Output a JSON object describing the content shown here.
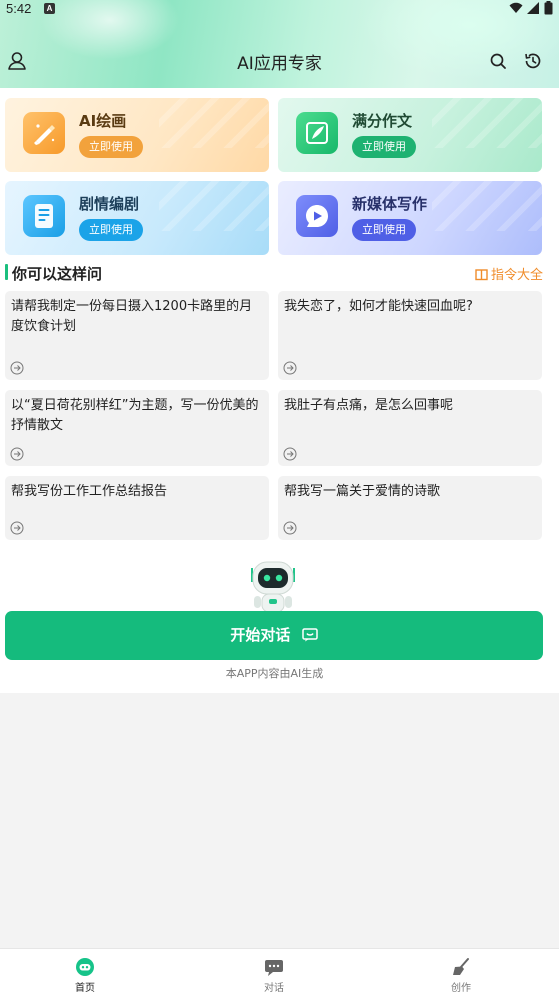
{
  "status_bar": {
    "time": "5:42",
    "notif": "A"
  },
  "header": {
    "title": "AI应用专家"
  },
  "cards": [
    {
      "title": "AI绘画",
      "button": "立即使用"
    },
    {
      "title": "满分作文",
      "button": "立即使用"
    },
    {
      "title": "剧情编剧",
      "button": "立即使用"
    },
    {
      "title": "新媒体写作",
      "button": "立即使用"
    }
  ],
  "section": {
    "title": "你可以这样问",
    "link": "指令大全"
  },
  "prompts": [
    "请帮我制定一份每日摄入1200卡路里的月度饮食计划",
    "我失恋了，如何才能快速回血呢?",
    "以“夏日荷花别样红”为主题，写一份优美的抒情散文",
    "我肚子有点痛，是怎么回事呢",
    "帮我写份工作工作总结报告",
    "帮我写一篇关于爱情的诗歌"
  ],
  "cta": {
    "label": "开始对话",
    "disclaimer": "本APP内容由AI生成"
  },
  "nav": [
    {
      "label": "首页",
      "icon": "home-robot-icon",
      "active": true
    },
    {
      "label": "对话",
      "icon": "chat-icon",
      "active": false
    },
    {
      "label": "创作",
      "icon": "broom-icon",
      "active": false
    }
  ],
  "colors": {
    "accent": "#15bb7d",
    "link": "#f08c2a"
  }
}
